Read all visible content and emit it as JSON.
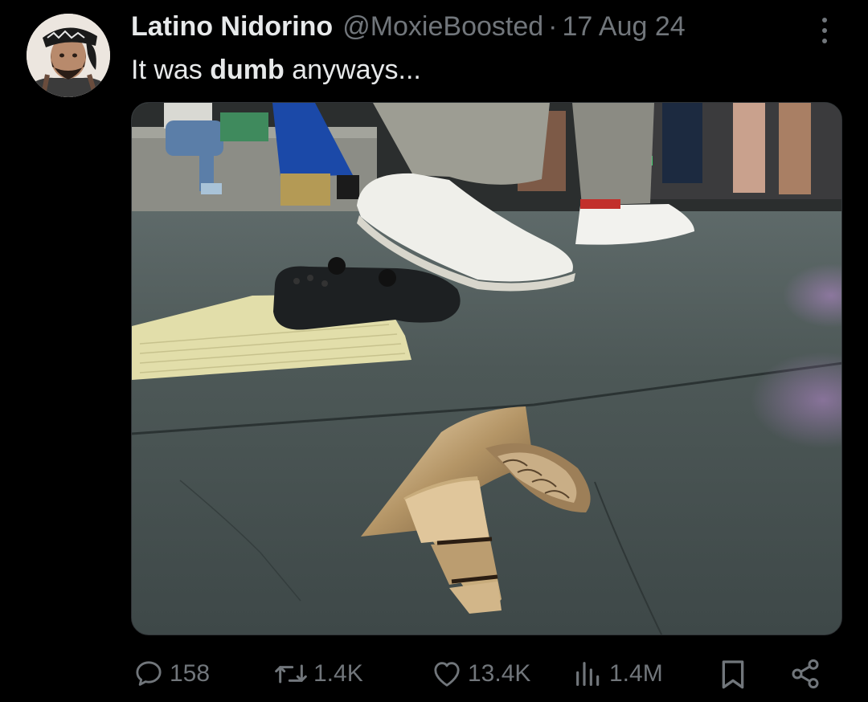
{
  "post": {
    "author_name": "Latino Nidorino",
    "handle": "@MoxieBoosted",
    "separator": "·",
    "date": "17 Aug 24",
    "text_before": "It was ",
    "text_bold": "dumb",
    "text_after": " anyways..."
  },
  "media": {
    "icon": "photo-image"
  },
  "actions": {
    "replies": "158",
    "reposts": "1.4K",
    "likes": "13.4K",
    "views": "1.4M"
  },
  "colors": {
    "background": "#000000",
    "primary_text": "#e7e9ea",
    "secondary_text": "#71767b"
  }
}
